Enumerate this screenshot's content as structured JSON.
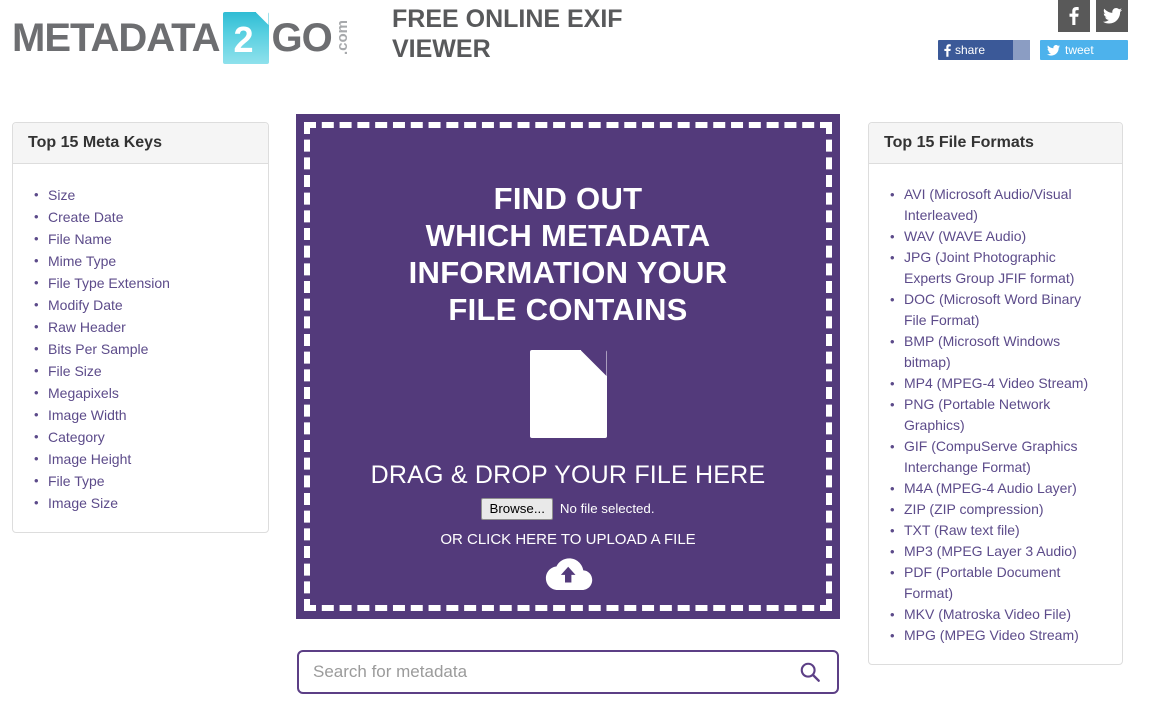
{
  "header": {
    "logo": {
      "part1": "METADATA",
      "badge": "2",
      "part2": "GO",
      "domain": ".com"
    },
    "title": "FREE ONLINE EXIF VIEWER",
    "social_icons": [
      {
        "name": "facebook-icon",
        "glyph": "f"
      },
      {
        "name": "twitter-icon",
        "glyph": "twitter-bird"
      }
    ],
    "facebook_share_label": "share",
    "twitter_tweet_label": "tweet"
  },
  "left_panel": {
    "title": "Top 15 Meta Keys",
    "items": [
      "Size",
      "Create Date",
      "File Name",
      "Mime Type",
      "File Type Extension",
      "Modify Date",
      "Raw Header",
      "Bits Per Sample",
      "File Size",
      "Megapixels",
      "Image Width",
      "Category",
      "Image Height",
      "File Type",
      "Image Size"
    ]
  },
  "right_panel": {
    "title": "Top 15 File Formats",
    "items": [
      "AVI (Microsoft Audio/Visual Interleaved)",
      "WAV (WAVE Audio)",
      "JPG (Joint Photographic Experts Group JFIF format)",
      "DOC (Microsoft Word Binary File Format)",
      "BMP (Microsoft Windows bitmap)",
      "MP4 (MPEG-4 Video Stream)",
      "PNG (Portable Network Graphics)",
      "GIF (CompuServe Graphics Interchange Format)",
      "M4A (MPEG-4 Audio Layer)",
      "ZIP (ZIP compression)",
      "TXT (Raw text file)",
      "MP3 (MPEG Layer 3 Audio)",
      "PDF (Portable Document Format)",
      "MKV (Matroska Video File)",
      "MPG (MPEG Video Stream)"
    ]
  },
  "dropzone": {
    "headline": "FIND OUT\nWHICH METADATA\nINFORMATION YOUR\nFILE CONTAINS",
    "headline_lines": [
      "FIND OUT",
      "WHICH METADATA",
      "INFORMATION YOUR",
      "FILE CONTAINS"
    ],
    "drag_text": "DRAG & DROP YOUR FILE HERE",
    "browse_label": "Browse...",
    "no_file_text": "No file selected.",
    "or_click_text": "OR CLICK HERE TO UPLOAD A FILE",
    "file_icon": "document-icon",
    "upload_icon": "cloud-upload-icon"
  },
  "search": {
    "placeholder": "Search for metadata",
    "value": "",
    "icon": "search-icon"
  },
  "colors": {
    "purple": "#533a7b",
    "purple_border": "#5c3f86",
    "link_purple": "#5c4b8a",
    "facebook_blue": "#3b5998",
    "facebook_light": "#8b9dc3",
    "twitter_blue": "#4db2ec",
    "social_gray": "#595959",
    "logo_gray": "#6d6e71",
    "logo_cyan": "#2fbcd4",
    "title_gray": "#58595b",
    "panel_border": "#dddddd",
    "panel_head_bg": "#f5f5f5"
  }
}
